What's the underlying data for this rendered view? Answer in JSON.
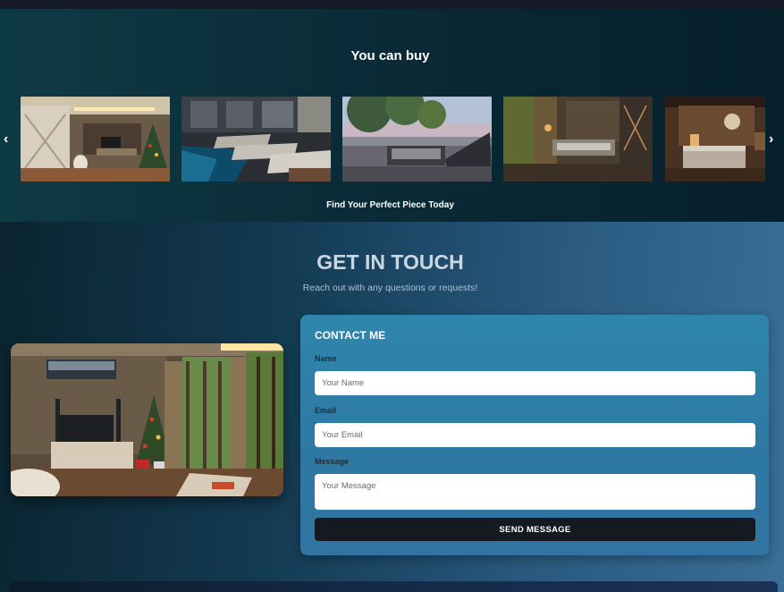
{
  "buy_section": {
    "title": "You can buy",
    "caption": "Find Your Perfect Piece Today",
    "prev_arrow": "‹",
    "next_arrow": "›"
  },
  "carousel": {
    "items": [
      {
        "scene": "living-room-with-christmas-tree"
      },
      {
        "scene": "pool-with-lounge-chairs"
      },
      {
        "scene": "terrace-with-sofa-and-trees"
      },
      {
        "scene": "lounge-with-glass-table"
      },
      {
        "scene": "bedroom-with-wood-panels"
      }
    ]
  },
  "touch_section": {
    "title": "GET IN TOUCH",
    "subtitle": "Reach out with any questions or requests!"
  },
  "contact_form": {
    "title": "CONTACT ME",
    "name_label": "Name",
    "name_placeholder": "Your Name",
    "email_label": "Email",
    "email_placeholder": "Your Email",
    "message_label": "Message",
    "message_placeholder": "Your Message",
    "send_label": "SEND MESSAGE"
  },
  "colors": {
    "button_bg": "#141a20",
    "card_bg": "#2f86ad"
  }
}
